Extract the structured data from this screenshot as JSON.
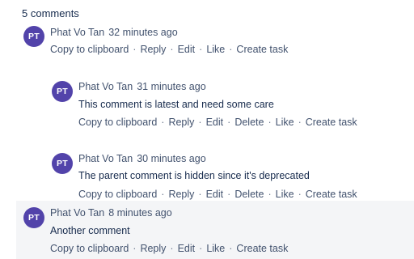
{
  "comment_count": "5 comments",
  "colors": {
    "avatar_bg": "#5243aa",
    "highlight_bg": "#f4f5f7"
  },
  "separator": "·",
  "comments": [
    {
      "avatar": "PT",
      "author": "Phat Vo Tan",
      "time": "32 minutes ago",
      "body": "",
      "actions": [
        "Copy to clipboard",
        "Reply",
        "Edit",
        "Like",
        "Create task"
      ]
    },
    {
      "avatar": "PT",
      "author": "Phat Vo Tan",
      "time": "31 minutes ago",
      "body": "This comment is latest and need some care",
      "actions": [
        "Copy to clipboard",
        "Reply",
        "Edit",
        "Delete",
        "Like",
        "Create task"
      ]
    },
    {
      "avatar": "PT",
      "author": "Phat Vo Tan",
      "time": "30 minutes ago",
      "body": "The parent comment is hidden since it's deprecated",
      "actions": [
        "Copy to clipboard",
        "Reply",
        "Edit",
        "Delete",
        "Like",
        "Create task"
      ]
    },
    {
      "avatar": "PT",
      "author": "Phat Vo Tan",
      "time": "8 minutes ago",
      "body": "Another comment",
      "actions": [
        "Copy to clipboard",
        "Reply",
        "Edit",
        "Like",
        "Create task"
      ]
    }
  ]
}
